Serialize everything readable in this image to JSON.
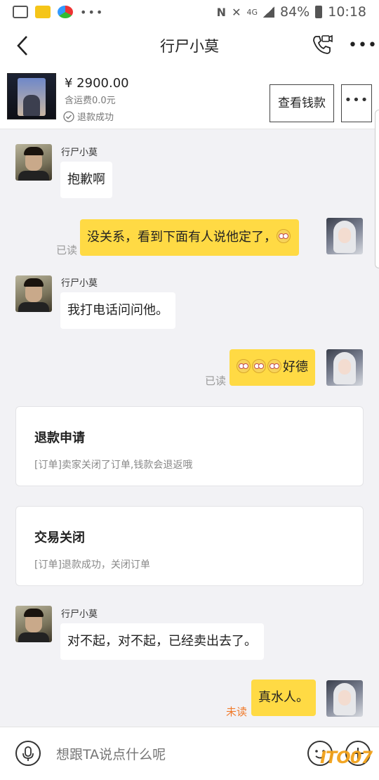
{
  "status_bar": {
    "battery": "84%",
    "time": "10:18",
    "network": "4G"
  },
  "header": {
    "title": "行尸小莫",
    "more": "•••"
  },
  "product": {
    "price": "¥ 2900.00",
    "shipping": "含运费0.0元",
    "status": "退款成功",
    "view_button": "查看钱款",
    "more_button": "•••"
  },
  "messages": [
    {
      "sender": "seller",
      "name": "行尸小莫",
      "text": "抱歉啊"
    },
    {
      "sender": "me",
      "text": "没关系，看到下面有人说他定了，",
      "read": "已读"
    },
    {
      "sender": "seller",
      "name": "行尸小莫",
      "text": "我打电话问问他。"
    },
    {
      "sender": "me",
      "text": "好德",
      "read": "已读"
    },
    {
      "sender": "seller",
      "name": "行尸小莫",
      "text": "对不起，对不起，已经卖出去了。"
    },
    {
      "sender": "me",
      "text": "真水人。",
      "read": "未读"
    }
  ],
  "cards": [
    {
      "title": "退款申请",
      "desc": "[订单]卖家关闭了订单,钱款会退返哦"
    },
    {
      "title": "交易关闭",
      "desc": "[订单]退款成功，关闭订单"
    }
  ],
  "input": {
    "placeholder": "想跟TA说点什么呢"
  },
  "watermark": "ITO07",
  "colors": {
    "bubble_me": "#ffda44",
    "bubble_other": "#ffffff",
    "unread": "#f07a2a",
    "background": "#f2f2f5"
  }
}
